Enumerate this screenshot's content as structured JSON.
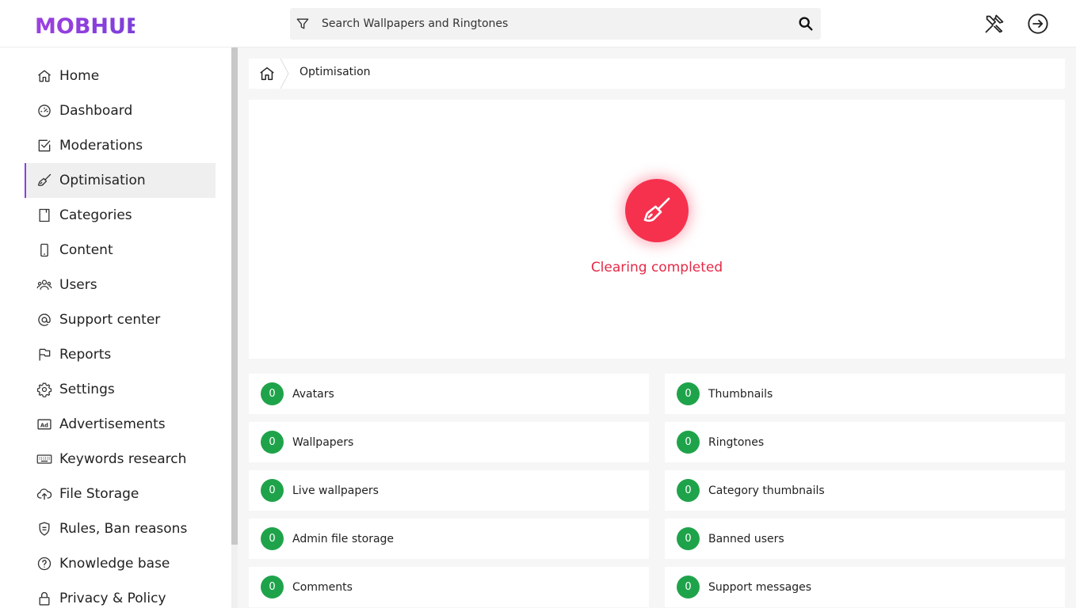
{
  "app": {
    "logo_text": "MOBHUB",
    "brand_color": "#8b3fe0"
  },
  "search": {
    "placeholder": "Search Wallpapers and Ringtones",
    "filter_icon": "filter-icon",
    "search_icon": "search-icon"
  },
  "header": {
    "tools_icon": "tools-icon",
    "logout_icon": "sign-in-icon"
  },
  "sidebar": {
    "items": [
      {
        "label": "Home",
        "icon": "home-icon"
      },
      {
        "label": "Dashboard",
        "icon": "gauge-icon"
      },
      {
        "label": "Moderations",
        "icon": "checkbox-icon"
      },
      {
        "label": "Optimisation",
        "icon": "broom-icon",
        "active": true
      },
      {
        "label": "Categories",
        "icon": "book-icon"
      },
      {
        "label": "Content",
        "icon": "phone-icon"
      },
      {
        "label": "Users",
        "icon": "users-icon"
      },
      {
        "label": "Support center",
        "icon": "at-icon"
      },
      {
        "label": "Reports",
        "icon": "flag-icon"
      },
      {
        "label": "Settings",
        "icon": "gear-icon"
      },
      {
        "label": "Advertisements",
        "icon": "ad-icon"
      },
      {
        "label": "Keywords research",
        "icon": "keyboard-icon"
      },
      {
        "label": "File Storage",
        "icon": "cloud-upload-icon"
      },
      {
        "label": "Rules, Ban reasons",
        "icon": "shield-icon"
      },
      {
        "label": "Knowledge base",
        "icon": "question-icon"
      },
      {
        "label": "Privacy & Policy",
        "icon": "lock-icon"
      }
    ]
  },
  "breadcrumb": {
    "home_icon": "home-icon",
    "current": "Optimisation"
  },
  "main": {
    "status_text": "Clearing completed",
    "status_color": "#e52a47",
    "action_icon": "broom-icon",
    "stats": [
      {
        "count": "0",
        "label": "Avatars"
      },
      {
        "count": "0",
        "label": "Thumbnails"
      },
      {
        "count": "0",
        "label": "Wallpapers"
      },
      {
        "count": "0",
        "label": "Ringtones"
      },
      {
        "count": "0",
        "label": "Live wallpapers"
      },
      {
        "count": "0",
        "label": "Category thumbnails"
      },
      {
        "count": "0",
        "label": "Admin file storage"
      },
      {
        "count": "0",
        "label": "Banned users"
      },
      {
        "count": "0",
        "label": "Comments"
      },
      {
        "count": "0",
        "label": "Support messages"
      }
    ]
  }
}
